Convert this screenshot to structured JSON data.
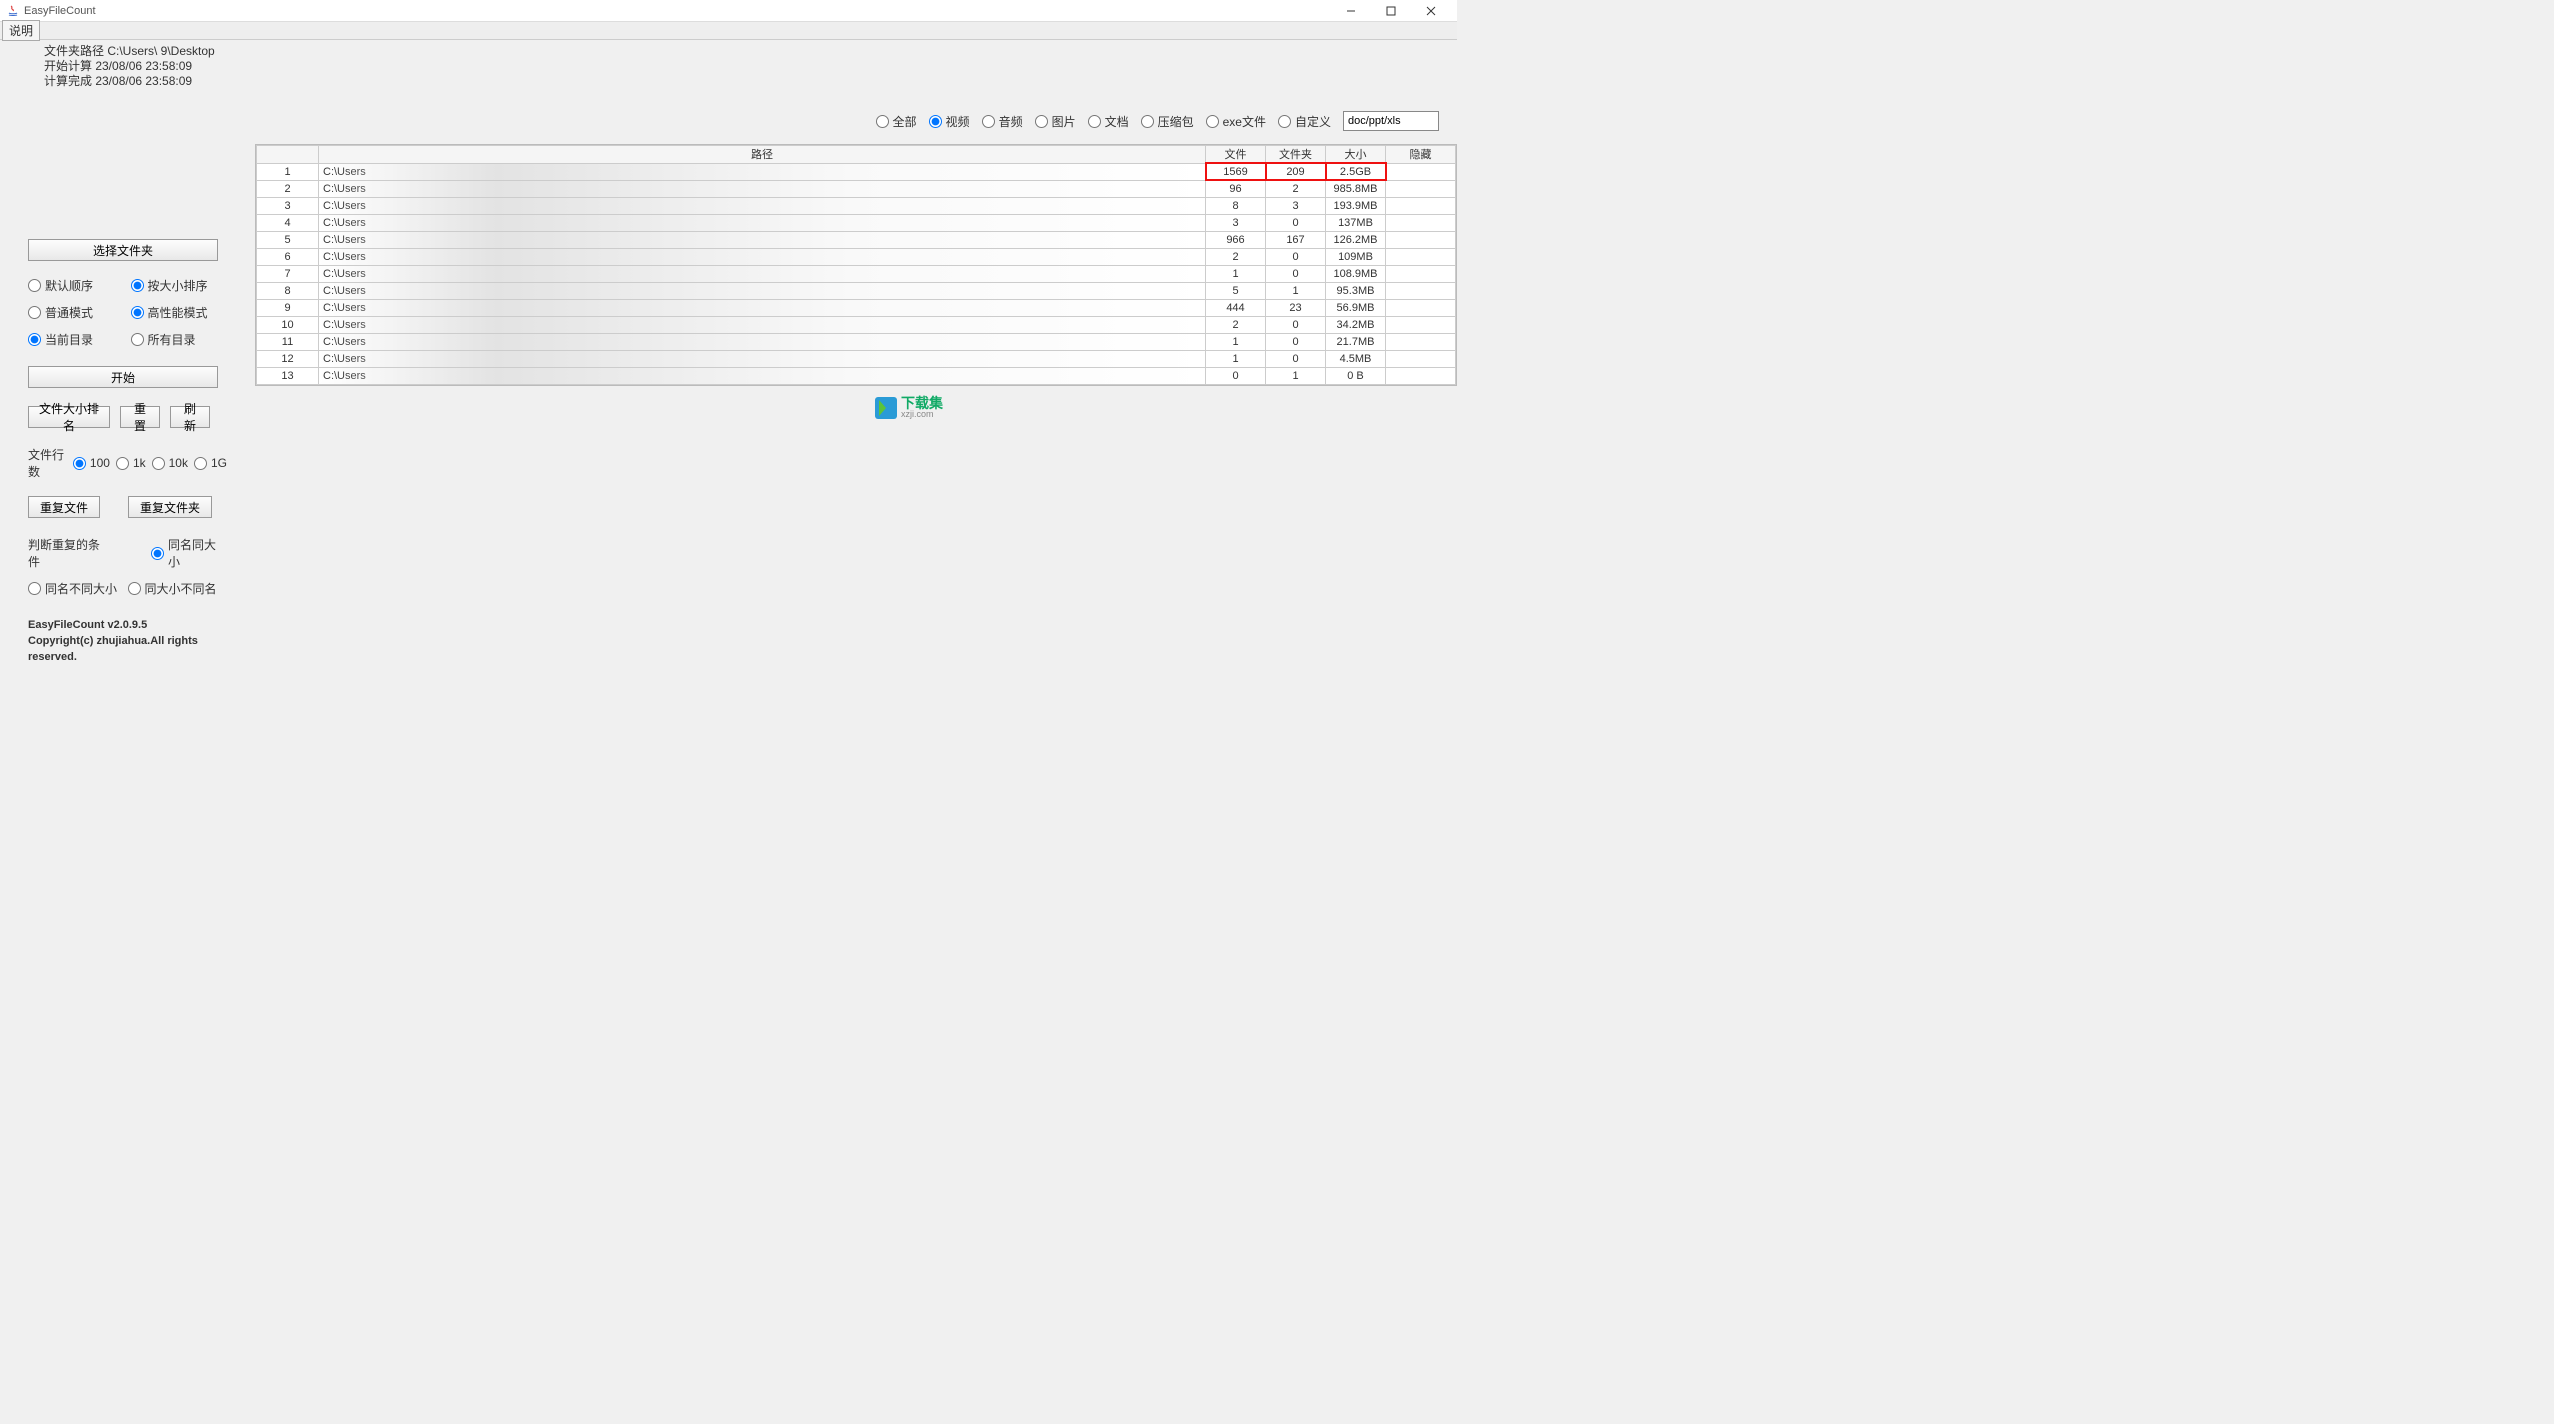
{
  "window": {
    "title": "EasyFileCount",
    "menu_explain": "说明"
  },
  "info": {
    "path_label": "文件夹路径 C:\\Users\\        9\\Desktop",
    "start_label": "开始计算 23/08/06 23:58:09",
    "done_label": "计算完成 23/08/06 23:58:09"
  },
  "left": {
    "select_folder": "选择文件夹",
    "sort_default": "默认顺序",
    "sort_size": "按大小排序",
    "mode_normal": "普通模式",
    "mode_perf": "高性能模式",
    "dir_current": "当前目录",
    "dir_all": "所有目录",
    "start": "开始",
    "rank_size": "文件大小排名",
    "reset": "重置",
    "refresh": "刷新",
    "file_rows_label": "文件行数",
    "r100": "100",
    "r1k": "1k",
    "r10k": "10k",
    "r1g": "1G",
    "dup_files": "重复文件",
    "dup_folders": "重复文件夹",
    "cond_label": "判断重复的条件",
    "cond_same_name_size": "同名同大小",
    "cond_same_name_diff_size": "同名不同大小",
    "cond_same_size_diff_name": "同大小不同名",
    "version": "EasyFileCount v2.0.9.5",
    "copyright": "Copyright(c) zhujiahua.All rights reserved."
  },
  "filters": {
    "all": "全部",
    "video": "视频",
    "audio": "音频",
    "image": "图片",
    "doc": "文档",
    "zip": "压缩包",
    "exe": "exe文件",
    "custom": "自定义",
    "custom_value": "doc/ppt/xls"
  },
  "table": {
    "headers": {
      "idx": "",
      "path": "路径",
      "files": "文件",
      "folders": "文件夹",
      "size": "大小",
      "hidden": "隐藏"
    },
    "rows": [
      {
        "idx": "1",
        "path": "C:\\Users",
        "files": "1569",
        "folders": "209",
        "size": "2.5GB",
        "hl": true
      },
      {
        "idx": "2",
        "path": "C:\\Users",
        "files": "96",
        "folders": "2",
        "size": "985.8MB"
      },
      {
        "idx": "3",
        "path": "C:\\Users",
        "files": "8",
        "folders": "3",
        "size": "193.9MB"
      },
      {
        "idx": "4",
        "path": "C:\\Users",
        "files": "3",
        "folders": "0",
        "size": "137MB"
      },
      {
        "idx": "5",
        "path": "C:\\Users",
        "files": "966",
        "folders": "167",
        "size": "126.2MB"
      },
      {
        "idx": "6",
        "path": "C:\\Users",
        "files": "2",
        "folders": "0",
        "size": "109MB"
      },
      {
        "idx": "7",
        "path": "C:\\Users",
        "files": "1",
        "folders": "0",
        "size": "108.9MB"
      },
      {
        "idx": "8",
        "path": "C:\\Users",
        "files": "5",
        "folders": "1",
        "size": "95.3MB"
      },
      {
        "idx": "9",
        "path": "C:\\Users",
        "files": "444",
        "folders": "23",
        "size": "56.9MB"
      },
      {
        "idx": "10",
        "path": "C:\\Users",
        "files": "2",
        "folders": "0",
        "size": "34.2MB"
      },
      {
        "idx": "11",
        "path": "C:\\Users",
        "files": "1",
        "folders": "0",
        "size": "21.7MB"
      },
      {
        "idx": "12",
        "path": "C:\\Users",
        "files": "1",
        "folders": "0",
        "size": "4.5MB"
      },
      {
        "idx": "13",
        "path": "C:\\Users",
        "files": "0",
        "folders": "1",
        "size": "0 B"
      }
    ]
  },
  "watermark": {
    "text": "下载集",
    "sub": "xzji.com"
  }
}
